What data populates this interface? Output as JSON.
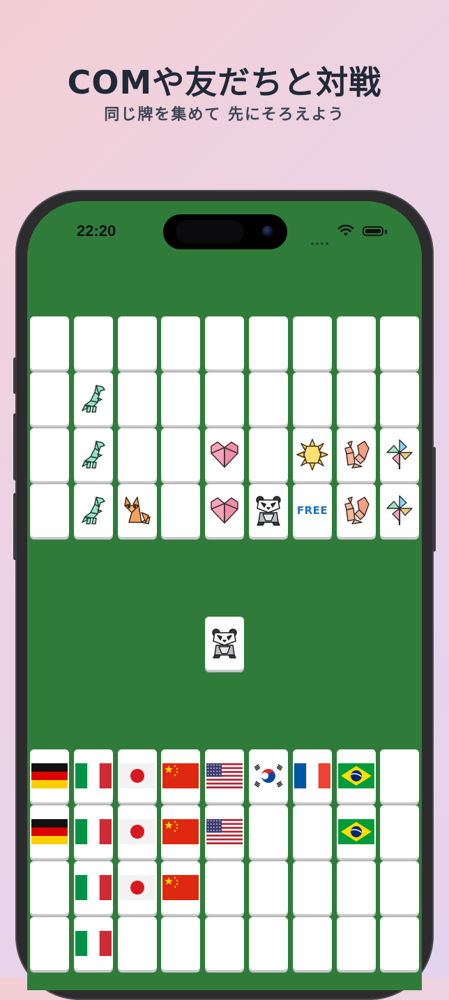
{
  "promo": {
    "headline": "COMや友だちと対戦",
    "subline": "同じ牌を集めて 先にそろえよう"
  },
  "status_bar": {
    "time": "22:20"
  },
  "colors": {
    "table_green": "#2f7c3a",
    "free_blue": "#1a72c0"
  },
  "opponent_board": {
    "rows": [
      [
        "blank",
        "blank",
        "blank",
        "blank",
        "blank",
        "blank",
        "blank",
        "blank",
        "blank"
      ],
      [
        "blank",
        "dinosaur",
        "blank",
        "blank",
        "blank",
        "blank",
        "blank",
        "blank",
        "blank"
      ],
      [
        "blank",
        "dinosaur",
        "blank",
        "blank",
        "heart",
        "blank",
        "sun",
        "squirrel",
        "pinwheel"
      ],
      [
        "blank",
        "dinosaur",
        "fox",
        "blank",
        "heart",
        "panda",
        "free",
        "squirrel",
        "pinwheel"
      ]
    ],
    "free_label": "FREE"
  },
  "drawn_tile": {
    "icon": "panda"
  },
  "player_board": {
    "rows": [
      [
        "germany",
        "italy",
        "japan",
        "china",
        "usa",
        "korea",
        "france",
        "brazil",
        "blank"
      ],
      [
        "germany",
        "italy",
        "japan",
        "china",
        "usa",
        "blank",
        "blank",
        "brazil",
        "blank"
      ],
      [
        "blank",
        "italy",
        "japan",
        "china",
        "blank",
        "blank",
        "blank",
        "blank",
        "blank"
      ],
      [
        "blank",
        "italy",
        "blank",
        "blank",
        "blank",
        "blank",
        "blank",
        "blank",
        "blank"
      ]
    ]
  }
}
